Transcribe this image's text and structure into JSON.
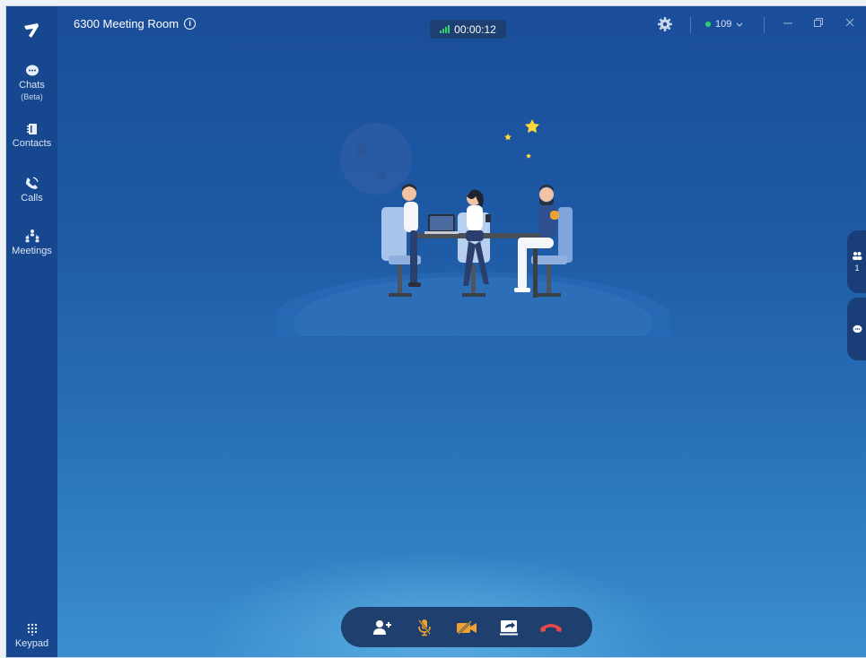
{
  "window": {
    "title": "6300 Meeting Room",
    "timer": "00:00:12",
    "account": "109"
  },
  "sidebar": {
    "items": [
      {
        "label": "Chats",
        "sub": "(Beta)",
        "icon": "chat-icon"
      },
      {
        "label": "Contacts",
        "icon": "contacts-icon"
      },
      {
        "label": "Calls",
        "icon": "phone-icon"
      },
      {
        "label": "Meetings",
        "icon": "meetings-icon"
      }
    ],
    "keypad": "Keypad"
  },
  "side_panel": {
    "participants_count": "1"
  },
  "toolbar": {
    "buttons": [
      "add-participant-icon",
      "mic-muted-icon",
      "camera-off-icon",
      "share-screen-icon",
      "hang-up-icon"
    ]
  },
  "colors": {
    "accent_green": "#2fd36a",
    "hangup_red": "#e84a4a",
    "mute_orange": "#f0a22e",
    "sidebar_bg": "#17478f"
  }
}
